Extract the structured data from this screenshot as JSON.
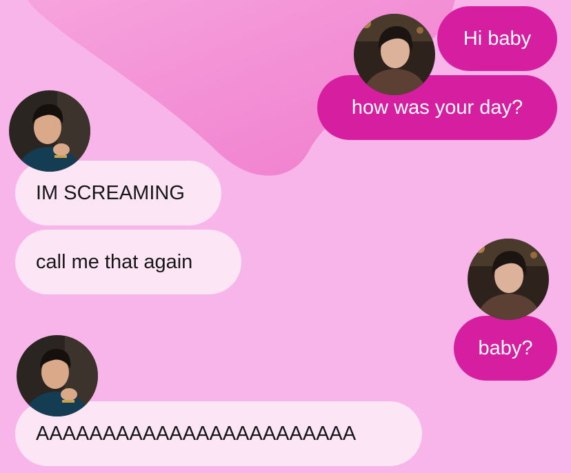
{
  "messages": [
    {
      "sender": "me",
      "text": "Hi baby"
    },
    {
      "sender": "me",
      "text": "how was your day?"
    },
    {
      "sender": "them",
      "text": "IM SCREAMING"
    },
    {
      "sender": "them",
      "text": "call me that again"
    },
    {
      "sender": "me",
      "text": "baby?"
    },
    {
      "sender": "them",
      "text": "AAAAAAAAAAAAAAAAAAAAAAAA"
    }
  ],
  "avatars": {
    "me": {
      "icon": "contact-photo-icon"
    },
    "them": {
      "icon": "contact-photo-icon"
    }
  },
  "colors": {
    "background": "#f7b5e9",
    "heart": "#f487d2",
    "outgoing_bubble": "#d61fa0",
    "outgoing_text": "#ffffff",
    "incoming_bubble": "#fce6f6",
    "incoming_text": "#161616"
  }
}
